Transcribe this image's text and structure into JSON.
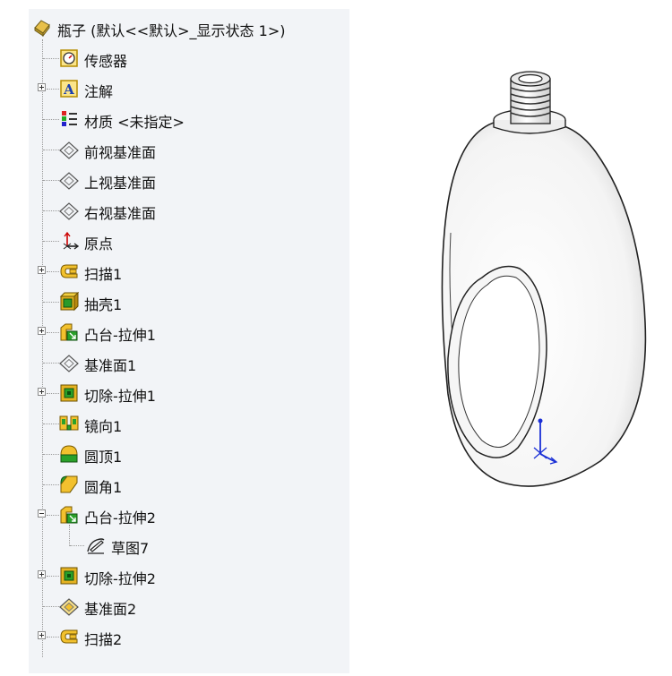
{
  "feature_tree": {
    "root": {
      "label": "瓶子 (默认<<默认>_显示状态 1>)",
      "icon": "part-icon"
    },
    "items": [
      {
        "label": "传感器",
        "icon": "sensor-icon"
      },
      {
        "label": "注解",
        "icon": "annotation-icon"
      },
      {
        "label": "材质 <未指定>",
        "icon": "material-icon"
      },
      {
        "label": "前视基准面",
        "icon": "plane-icon"
      },
      {
        "label": "上视基准面",
        "icon": "plane-icon"
      },
      {
        "label": "右视基准面",
        "icon": "plane-icon"
      },
      {
        "label": "原点",
        "icon": "origin-icon"
      },
      {
        "label": "扫描1",
        "icon": "sweep-icon"
      },
      {
        "label": "抽壳1",
        "icon": "shell-icon"
      },
      {
        "label": "凸台-拉伸1",
        "icon": "boss-extrude-icon"
      },
      {
        "label": "基准面1",
        "icon": "plane-icon"
      },
      {
        "label": "切除-拉伸1",
        "icon": "cut-extrude-icon"
      },
      {
        "label": "镜向1",
        "icon": "mirror-icon"
      },
      {
        "label": "圆顶1",
        "icon": "dome-icon"
      },
      {
        "label": "圆角1",
        "icon": "fillet-icon"
      },
      {
        "label": "凸台-拉伸2",
        "icon": "boss-extrude-icon"
      },
      {
        "label": "草图7",
        "icon": "sketch-icon"
      },
      {
        "label": "切除-拉伸2",
        "icon": "cut-extrude-icon"
      },
      {
        "label": "基准面2",
        "icon": "plane-selected-icon"
      },
      {
        "label": "扫描2",
        "icon": "sweep-icon"
      }
    ]
  },
  "model_view": {
    "part": "bottle-model",
    "triad": "origin-triad"
  }
}
